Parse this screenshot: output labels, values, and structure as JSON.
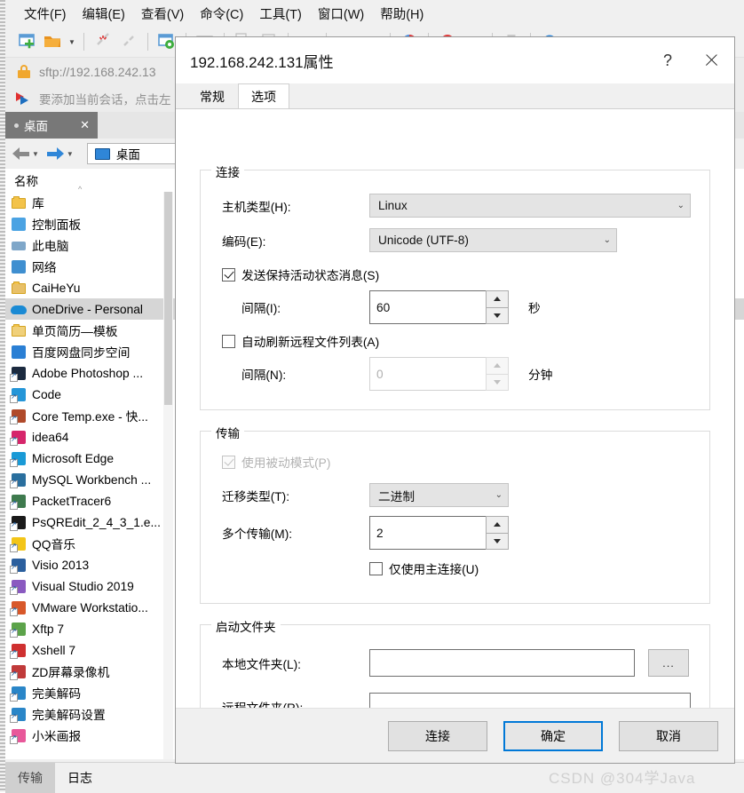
{
  "app": {
    "menu": [
      {
        "label": "文件(F)"
      },
      {
        "label": "编辑(E)"
      },
      {
        "label": "查看(V)"
      },
      {
        "label": "命令(C)"
      },
      {
        "label": "工具(T)"
      },
      {
        "label": "窗口(W)"
      },
      {
        "label": "帮助(H)"
      }
    ],
    "address": "sftp://192.168.242.13",
    "notice": "要添加当前会话，点击左",
    "session_tab": {
      "label": "桌面",
      "close": "✕"
    },
    "path": "桌面",
    "column_header": "名称",
    "bottom_tabs": [
      {
        "label": "传输",
        "active": true
      },
      {
        "label": "日志",
        "active": false
      }
    ],
    "files": [
      {
        "name": "库",
        "icon": "folder-icon",
        "color": "#f3c34a",
        "selected": false,
        "shortcut": false
      },
      {
        "name": "控制面板",
        "icon": "control-panel-icon",
        "color": "#4ba3e3",
        "selected": false,
        "shortcut": false
      },
      {
        "name": "此电脑",
        "icon": "this-pc-icon",
        "color": "#7fa7c9",
        "selected": false,
        "shortcut": false
      },
      {
        "name": "网络",
        "icon": "network-icon",
        "color": "#3f8fd0",
        "selected": false,
        "shortcut": false
      },
      {
        "name": "CaiHeYu",
        "icon": "user-folder-icon",
        "color": "#e8c068",
        "selected": false,
        "shortcut": false
      },
      {
        "name": "OneDrive - Personal",
        "icon": "onedrive-icon",
        "color": "#1a8ad4",
        "selected": true,
        "shortcut": false
      },
      {
        "name": "单页简历—模板",
        "icon": "folder-icon",
        "color": "#f0d07a",
        "selected": false,
        "shortcut": false
      },
      {
        "name": "百度网盘同步空间",
        "icon": "baidu-netdisk-icon",
        "color": "#2a7fd4",
        "selected": false,
        "shortcut": false
      },
      {
        "name": "Adobe Photoshop ...",
        "icon": "photoshop-icon",
        "color": "#1b2a3f",
        "selected": false,
        "shortcut": true
      },
      {
        "name": "Code",
        "icon": "vscode-icon",
        "color": "#2596d8",
        "selected": false,
        "shortcut": true
      },
      {
        "name": "Core Temp.exe - 快...",
        "icon": "coretemp-icon",
        "color": "#b04a2a",
        "selected": false,
        "shortcut": true
      },
      {
        "name": "idea64",
        "icon": "intellij-icon",
        "color": "#d6266b",
        "selected": false,
        "shortcut": true
      },
      {
        "name": "Microsoft Edge",
        "icon": "edge-icon",
        "color": "#1a9ad6",
        "selected": false,
        "shortcut": true
      },
      {
        "name": "MySQL Workbench ...",
        "icon": "mysql-workbench-icon",
        "color": "#2a6f9e",
        "selected": false,
        "shortcut": true
      },
      {
        "name": "PacketTracer6",
        "icon": "packettracer-icon",
        "color": "#3e7a4e",
        "selected": false,
        "shortcut": true
      },
      {
        "name": "PsQREdit_2_4_3_1.e...",
        "icon": "qrcode-icon",
        "color": "#1a1a1a",
        "selected": false,
        "shortcut": true
      },
      {
        "name": "QQ音乐",
        "icon": "qqmusic-icon",
        "color": "#f3c518",
        "selected": false,
        "shortcut": true
      },
      {
        "name": "Visio 2013",
        "icon": "visio-icon",
        "color": "#2b5f9e",
        "selected": false,
        "shortcut": true
      },
      {
        "name": "Visual Studio 2019",
        "icon": "visualstudio-icon",
        "color": "#8a5ac0",
        "selected": false,
        "shortcut": true
      },
      {
        "name": "VMware Workstatio...",
        "icon": "vmware-icon",
        "color": "#d8582a",
        "selected": false,
        "shortcut": true
      },
      {
        "name": "Xftp 7",
        "icon": "xftp-icon",
        "color": "#5ca34a",
        "selected": false,
        "shortcut": true
      },
      {
        "name": "Xshell 7",
        "icon": "xshell-icon",
        "color": "#cf3030",
        "selected": false,
        "shortcut": true
      },
      {
        "name": "ZD屏幕录像机",
        "icon": "zd-recorder-icon",
        "color": "#c03a3a",
        "selected": false,
        "shortcut": true
      },
      {
        "name": "完美解码",
        "icon": "player-icon",
        "color": "#2a86c8",
        "selected": false,
        "shortcut": true
      },
      {
        "name": "完美解码设置",
        "icon": "player-settings-icon",
        "color": "#2a86c8",
        "selected": false,
        "shortcut": true
      },
      {
        "name": "小米画报",
        "icon": "mi-wallpaper-icon",
        "color": "#e8589a",
        "selected": false,
        "shortcut": true
      }
    ]
  },
  "dialog": {
    "title": "192.168.242.131属性",
    "help_label": "?",
    "close_label": "✕",
    "tabs": [
      {
        "label": "常规",
        "active": false
      },
      {
        "label": "选项",
        "active": true
      }
    ],
    "connection": {
      "legend": "连接",
      "host_type_label": "主机类型(H):",
      "host_type_value": "Linux",
      "encoding_label": "编码(E):",
      "encoding_value": "Unicode (UTF-8)",
      "keepalive_label": "发送保持活动状态消息(S)",
      "keepalive_checked": true,
      "keepalive_interval_label": "间隔(I):",
      "keepalive_interval_value": "60",
      "keepalive_unit": "秒",
      "autorefresh_label": "自动刷新远程文件列表(A)",
      "autorefresh_checked": false,
      "autorefresh_interval_label": "间隔(N):",
      "autorefresh_interval_value": "0",
      "autorefresh_unit": "分钟"
    },
    "transfer": {
      "legend": "传输",
      "passive_label": "使用被动模式(P)",
      "passive_checked": true,
      "passive_disabled": true,
      "migration_type_label": "迁移类型(T):",
      "migration_type_value": "二进制",
      "multi_transfer_label": "多个传输(M):",
      "multi_transfer_value": "2",
      "primary_only_label": "仅使用主连接(U)",
      "primary_only_checked": false
    },
    "startup_folder": {
      "legend": "启动文件夹",
      "local_label": "本地文件夹(L):",
      "local_value": "",
      "browse_label": "...",
      "remote_label": "远程文件夹(R):",
      "remote_value": ""
    },
    "buttons": [
      {
        "label": "连接",
        "default": false
      },
      {
        "label": "确定",
        "default": true
      },
      {
        "label": "取消",
        "default": false
      }
    ]
  },
  "watermark": "CSDN @304学Java",
  "colors": {
    "accent": "#0078d7",
    "dialog_bg": "#f0f0f0",
    "selection": "#d6d6d6"
  }
}
